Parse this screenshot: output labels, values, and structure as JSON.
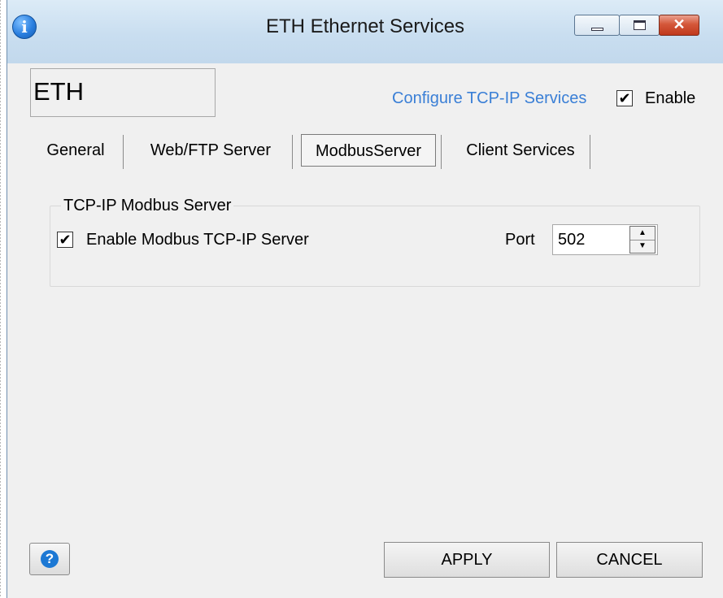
{
  "window": {
    "title": "ETH Ethernet Services",
    "app_icon": "info-icon",
    "app_icon_glyph": "i",
    "close_glyph": "✕"
  },
  "header": {
    "module_name": "ETH",
    "configure_link": "Configure TCP-IP Services",
    "enable_checkbox": {
      "label": "Enable",
      "checked": true,
      "glyph": "✔"
    }
  },
  "tabs": [
    {
      "label": "General",
      "active": false
    },
    {
      "label": "Web/FTP Server",
      "active": false
    },
    {
      "label": "ModbusServer",
      "active": true
    },
    {
      "label": "Client Services",
      "active": false
    }
  ],
  "modbus_group": {
    "title": "TCP-IP Modbus Server",
    "enable_checkbox": {
      "label": "Enable Modbus TCP-IP Server",
      "checked": true,
      "glyph": "✔"
    },
    "port": {
      "label": "Port",
      "value": "502",
      "up_glyph": "▲",
      "down_glyph": "▼"
    }
  },
  "footer": {
    "help_icon": "question-icon",
    "help_glyph": "?",
    "apply_label": "APPLY",
    "cancel_label": "CANCEL"
  },
  "colors": {
    "link": "#3a7fd6",
    "close_button": "#c0391c",
    "help_icon": "#1c78d4"
  }
}
